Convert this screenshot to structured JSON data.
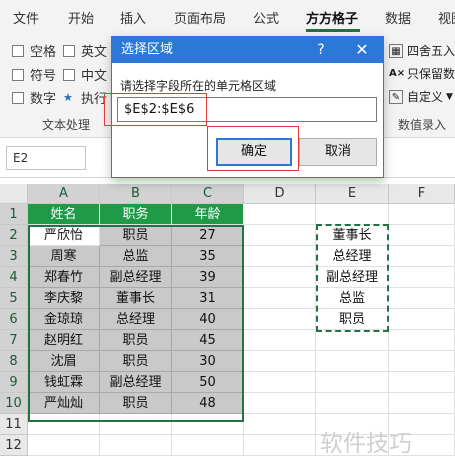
{
  "ribbon": {
    "tabs": [
      "文件",
      "开始",
      "插入",
      "页面布局",
      "公式",
      "方方格子",
      "数据",
      "视图"
    ],
    "active_tab": "方方格子",
    "checkboxes": [
      {
        "label": "空格",
        "checked": false
      },
      {
        "label": "英文",
        "checked": false
      },
      {
        "label": "符号",
        "checked": false
      },
      {
        "label": "中文",
        "checked": false
      },
      {
        "label": "数字",
        "checked": false
      },
      {
        "label": "执行",
        "checked": true
      }
    ],
    "group_text": "文本处理",
    "right_commands": [
      "四舍五入",
      "只保留数",
      "自定义"
    ],
    "group_numeric": "数值录入",
    "accent_color": "#217346"
  },
  "formula_bar": {
    "name_box": "E2"
  },
  "sheet": {
    "columns": [
      "A",
      "B",
      "C",
      "D",
      "E",
      "F"
    ],
    "rows": [
      "1",
      "2",
      "3",
      "4",
      "5",
      "6",
      "7",
      "8",
      "9",
      "10",
      "11",
      "12"
    ],
    "headers": [
      "姓名",
      "职务",
      "年龄"
    ],
    "records": [
      [
        "严欣怡",
        "职员",
        "27"
      ],
      [
        "周寒",
        "总监",
        "35"
      ],
      [
        "郑春竹",
        "副总经理",
        "39"
      ],
      [
        "李庆黎",
        "董事长",
        "31"
      ],
      [
        "金琼琼",
        "总经理",
        "40"
      ],
      [
        "赵明红",
        "职员",
        "45"
      ],
      [
        "沈眉",
        "职员",
        "30"
      ],
      [
        "钱虹霖",
        "副总经理",
        "50"
      ],
      [
        "严灿灿",
        "职员",
        "48"
      ]
    ],
    "column_e": [
      "董事长",
      "总经理",
      "副总经理",
      "总监",
      "职员"
    ]
  },
  "dialog": {
    "title": "选择区域",
    "help": "?",
    "close": "✕",
    "prompt": "请选择字段所在的单元格区域",
    "range_value": "$E$2:$E$6",
    "ok_label": "确定",
    "cancel_label": "取消"
  },
  "watermark": "软件技巧"
}
